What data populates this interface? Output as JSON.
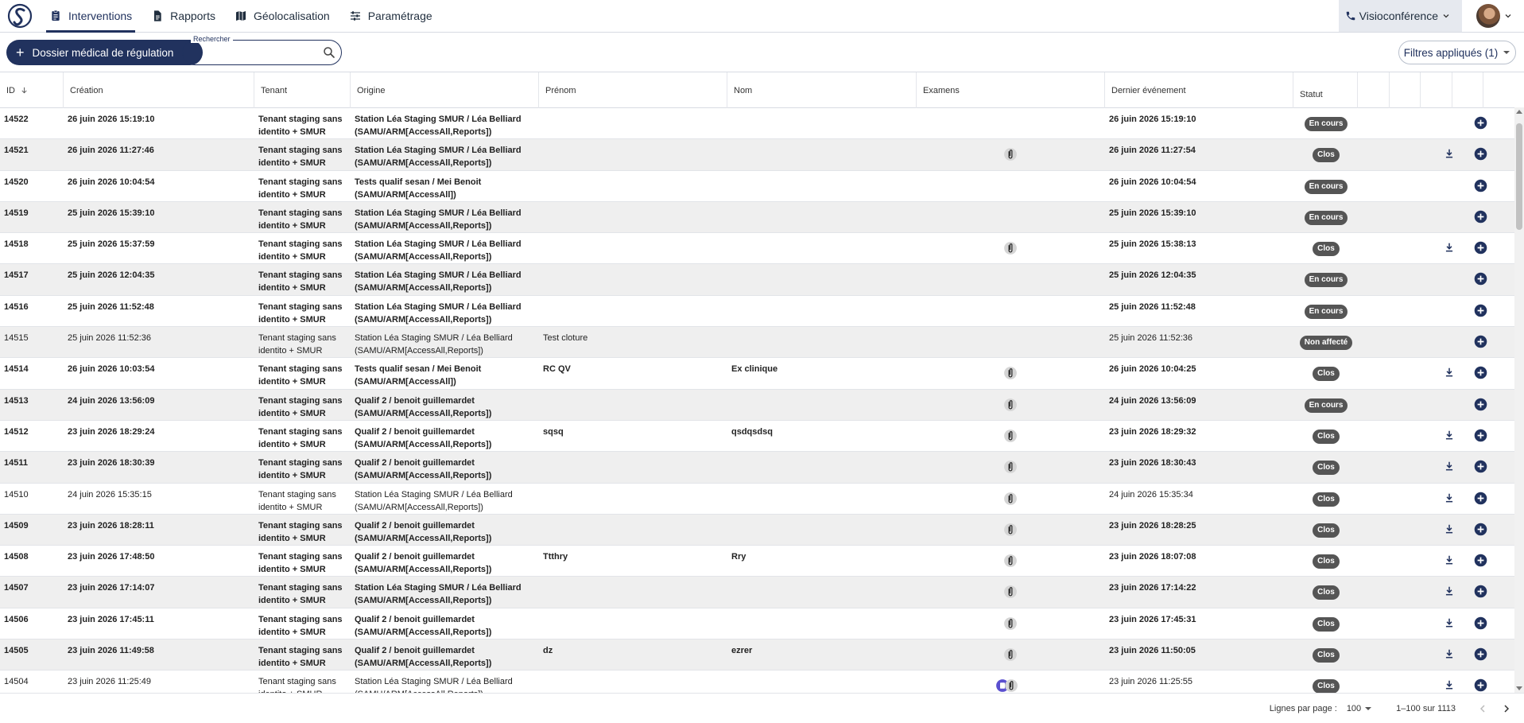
{
  "nav": {
    "tabs": [
      {
        "label": "Interventions",
        "icon": "clipboard-icon",
        "active": true
      },
      {
        "label": "Rapports",
        "icon": "document-icon",
        "active": false
      },
      {
        "label": "Géolocalisation",
        "icon": "map-icon",
        "active": false
      },
      {
        "label": "Paramétrage",
        "icon": "sliders-icon",
        "active": false
      }
    ],
    "visio_label": "Visioconférence"
  },
  "toolbar": {
    "new_button_label": "Dossier médical de régulation",
    "search_legend": "Rechercher",
    "search_value": "",
    "filters_label": "Filtres appliqués (1)"
  },
  "columns": [
    "ID",
    "Création",
    "Tenant",
    "Origine",
    "Prénom",
    "Nom",
    "Examens",
    "Dernier événement",
    "Statut"
  ],
  "colors": {
    "primary": "#21325e",
    "badge": "#555555",
    "row_alt": "#efefef"
  },
  "rows": [
    {
      "id": "14522",
      "creation": "26 juin 2026 15:19:10",
      "tenant": "Tenant staging sans identito + SMUR",
      "origine": "Station Léa Staging SMUR / Léa Belliard (SAMU/ARM[AccessAll,Reports])",
      "prenom": "",
      "nom": "",
      "exam": "",
      "dernier": "26 juin 2026 15:19:10",
      "statut": "En cours",
      "bold": true,
      "download": false
    },
    {
      "id": "14521",
      "creation": "26 juin 2026 11:27:46",
      "tenant": "Tenant staging sans identito + SMUR",
      "origine": "Station Léa Staging SMUR / Léa Belliard (SAMU/ARM[AccessAll,Reports])",
      "prenom": "",
      "nom": "",
      "exam": "clip",
      "dernier": "26 juin 2026 11:27:54",
      "statut": "Clos",
      "bold": true,
      "download": true
    },
    {
      "id": "14520",
      "creation": "26 juin 2026 10:04:54",
      "tenant": "Tenant staging sans identito + SMUR",
      "origine": "Tests qualif sesan / Mei Benoit (SAMU/ARM[AccessAll])",
      "prenom": "",
      "nom": "",
      "exam": "",
      "dernier": "26 juin 2026 10:04:54",
      "statut": "En cours",
      "bold": true,
      "download": false
    },
    {
      "id": "14519",
      "creation": "25 juin 2026 15:39:10",
      "tenant": "Tenant staging sans identito + SMUR",
      "origine": "Station Léa Staging SMUR / Léa Belliard (SAMU/ARM[AccessAll,Reports])",
      "prenom": "",
      "nom": "",
      "exam": "",
      "dernier": "25 juin 2026 15:39:10",
      "statut": "En cours",
      "bold": true,
      "download": false
    },
    {
      "id": "14518",
      "creation": "25 juin 2026 15:37:59",
      "tenant": "Tenant staging sans identito + SMUR",
      "origine": "Station Léa Staging SMUR / Léa Belliard (SAMU/ARM[AccessAll,Reports])",
      "prenom": "",
      "nom": "",
      "exam": "clip",
      "dernier": "25 juin 2026 15:38:13",
      "statut": "Clos",
      "bold": true,
      "download": true
    },
    {
      "id": "14517",
      "creation": "25 juin 2026 12:04:35",
      "tenant": "Tenant staging sans identito + SMUR",
      "origine": "Station Léa Staging SMUR / Léa Belliard (SAMU/ARM[AccessAll,Reports])",
      "prenom": "",
      "nom": "",
      "exam": "",
      "dernier": "25 juin 2026 12:04:35",
      "statut": "En cours",
      "bold": true,
      "download": false
    },
    {
      "id": "14516",
      "creation": "25 juin 2026 11:52:48",
      "tenant": "Tenant staging sans identito + SMUR",
      "origine": "Station Léa Staging SMUR / Léa Belliard (SAMU/ARM[AccessAll,Reports])",
      "prenom": "",
      "nom": "",
      "exam": "",
      "dernier": "25 juin 2026 11:52:48",
      "statut": "En cours",
      "bold": true,
      "download": false
    },
    {
      "id": "14515",
      "creation": "25 juin 2026 11:52:36",
      "tenant": "Tenant staging sans identito + SMUR",
      "origine": "Station Léa Staging SMUR / Léa Belliard (SAMU/ARM[AccessAll,Reports])",
      "prenom": "Test cloture",
      "nom": "",
      "exam": "",
      "dernier": "25 juin 2026 11:52:36",
      "statut": "Non affecté",
      "bold": false,
      "download": false
    },
    {
      "id": "14514",
      "creation": "26 juin 2026 10:03:54",
      "tenant": "Tenant staging sans identito + SMUR",
      "origine": "Tests qualif sesan / Mei Benoit (SAMU/ARM[AccessAll])",
      "prenom": "RC QV",
      "nom": "Ex clinique",
      "exam": "clip",
      "dernier": "26 juin 2026 10:04:25",
      "statut": "Clos",
      "bold": true,
      "download": true
    },
    {
      "id": "14513",
      "creation": "24 juin 2026 13:56:09",
      "tenant": "Tenant staging sans identito + SMUR",
      "origine": "Qualif 2 / benoit guillemardet (SAMU/ARM[AccessAll,Reports])",
      "prenom": "",
      "nom": "",
      "exam": "clip",
      "dernier": "24 juin 2026 13:56:09",
      "statut": "En cours",
      "bold": true,
      "download": false
    },
    {
      "id": "14512",
      "creation": "23 juin 2026 18:29:24",
      "tenant": "Tenant staging sans identito + SMUR",
      "origine": "Qualif 2 / benoit guillemardet (SAMU/ARM[AccessAll,Reports])",
      "prenom": "sqsq",
      "nom": "qsdqsdsq",
      "exam": "clip",
      "dernier": "23 juin 2026 18:29:32",
      "statut": "Clos",
      "bold": true,
      "download": true
    },
    {
      "id": "14511",
      "creation": "23 juin 2026 18:30:39",
      "tenant": "Tenant staging sans identito + SMUR",
      "origine": "Qualif 2 / benoit guillemardet (SAMU/ARM[AccessAll,Reports])",
      "prenom": "",
      "nom": "",
      "exam": "clip",
      "dernier": "23 juin 2026 18:30:43",
      "statut": "Clos",
      "bold": true,
      "download": true
    },
    {
      "id": "14510",
      "creation": "24 juin 2026 15:35:15",
      "tenant": "Tenant staging sans identito + SMUR",
      "origine": "Station Léa Staging SMUR / Léa Belliard (SAMU/ARM[AccessAll,Reports])",
      "prenom": "",
      "nom": "",
      "exam": "clip",
      "dernier": "24 juin 2026 15:35:34",
      "statut": "Clos",
      "bold": false,
      "download": true
    },
    {
      "id": "14509",
      "creation": "23 juin 2026 18:28:11",
      "tenant": "Tenant staging sans identito + SMUR",
      "origine": "Qualif 2 / benoit guillemardet (SAMU/ARM[AccessAll,Reports])",
      "prenom": "",
      "nom": "",
      "exam": "clip",
      "dernier": "23 juin 2026 18:28:25",
      "statut": "Clos",
      "bold": true,
      "download": true
    },
    {
      "id": "14508",
      "creation": "23 juin 2026 17:48:50",
      "tenant": "Tenant staging sans identito + SMUR",
      "origine": "Qualif 2 / benoit guillemardet (SAMU/ARM[AccessAll,Reports])",
      "prenom": "Ttthry",
      "nom": "Rry",
      "exam": "clip",
      "dernier": "23 juin 2026 18:07:08",
      "statut": "Clos",
      "bold": true,
      "download": true
    },
    {
      "id": "14507",
      "creation": "23 juin 2026 17:14:07",
      "tenant": "Tenant staging sans identito + SMUR",
      "origine": "Station Léa Staging SMUR / Léa Belliard (SAMU/ARM[AccessAll,Reports])",
      "prenom": "",
      "nom": "",
      "exam": "clip",
      "dernier": "23 juin 2026 17:14:22",
      "statut": "Clos",
      "bold": true,
      "download": true
    },
    {
      "id": "14506",
      "creation": "23 juin 2026 17:45:11",
      "tenant": "Tenant staging sans identito + SMUR",
      "origine": "Qualif 2 / benoit guillemardet (SAMU/ARM[AccessAll,Reports])",
      "prenom": "",
      "nom": "",
      "exam": "clip",
      "dernier": "23 juin 2026 17:45:31",
      "statut": "Clos",
      "bold": true,
      "download": true
    },
    {
      "id": "14505",
      "creation": "23 juin 2026 11:49:58",
      "tenant": "Tenant staging sans identito + SMUR",
      "origine": "Qualif 2 / benoit guillemardet (SAMU/ARM[AccessAll,Reports])",
      "prenom": "dz",
      "nom": "ezrer",
      "exam": "clip",
      "dernier": "23 juin 2026 11:50:05",
      "statut": "Clos",
      "bold": true,
      "download": true
    },
    {
      "id": "14504",
      "creation": "23 juin 2026 11:25:49",
      "tenant": "Tenant staging sans identito + SMUR",
      "origine": "Station Léa Staging SMUR / Léa Belliard (SAMU/ARM[AccessAll,Reports])",
      "prenom": "",
      "nom": "",
      "exam": "clip2",
      "dernier": "23 juin 2026 11:25:55",
      "statut": "Clos",
      "bold": false,
      "download": true
    }
  ],
  "footer": {
    "rows_per_page_label": "Lignes par page :",
    "rows_per_page_value": "100",
    "range_label": "1–100 sur 1113"
  }
}
